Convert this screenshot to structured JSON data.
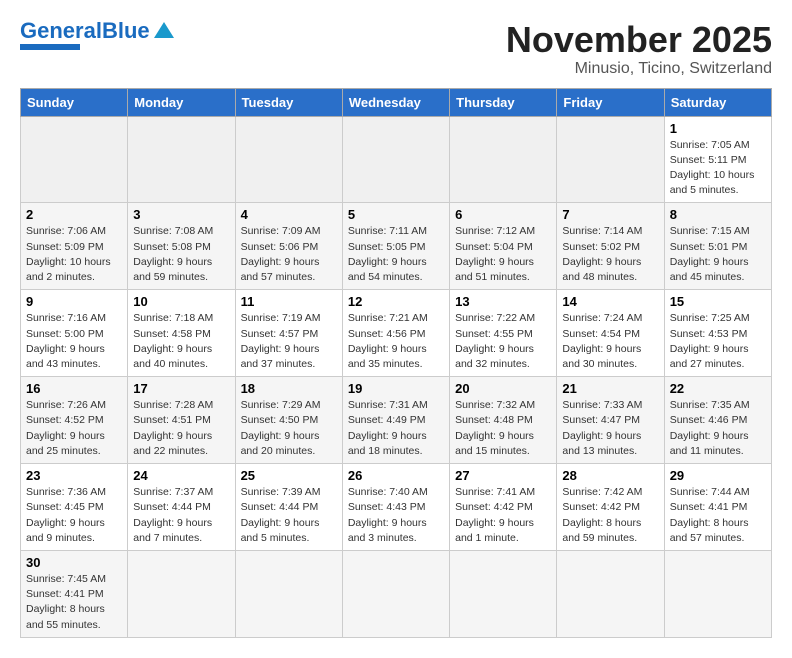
{
  "header": {
    "logo_general": "General",
    "logo_blue": "Blue",
    "month": "November 2025",
    "location": "Minusio, Ticino, Switzerland"
  },
  "days_of_week": [
    "Sunday",
    "Monday",
    "Tuesday",
    "Wednesday",
    "Thursday",
    "Friday",
    "Saturday"
  ],
  "weeks": [
    [
      {
        "num": "",
        "info": ""
      },
      {
        "num": "",
        "info": ""
      },
      {
        "num": "",
        "info": ""
      },
      {
        "num": "",
        "info": ""
      },
      {
        "num": "",
        "info": ""
      },
      {
        "num": "",
        "info": ""
      },
      {
        "num": "1",
        "info": "Sunrise: 7:05 AM\nSunset: 5:11 PM\nDaylight: 10 hours and 5 minutes."
      }
    ],
    [
      {
        "num": "2",
        "info": "Sunrise: 7:06 AM\nSunset: 5:09 PM\nDaylight: 10 hours and 2 minutes."
      },
      {
        "num": "3",
        "info": "Sunrise: 7:08 AM\nSunset: 5:08 PM\nDaylight: 9 hours and 59 minutes."
      },
      {
        "num": "4",
        "info": "Sunrise: 7:09 AM\nSunset: 5:06 PM\nDaylight: 9 hours and 57 minutes."
      },
      {
        "num": "5",
        "info": "Sunrise: 7:11 AM\nSunset: 5:05 PM\nDaylight: 9 hours and 54 minutes."
      },
      {
        "num": "6",
        "info": "Sunrise: 7:12 AM\nSunset: 5:04 PM\nDaylight: 9 hours and 51 minutes."
      },
      {
        "num": "7",
        "info": "Sunrise: 7:14 AM\nSunset: 5:02 PM\nDaylight: 9 hours and 48 minutes."
      },
      {
        "num": "8",
        "info": "Sunrise: 7:15 AM\nSunset: 5:01 PM\nDaylight: 9 hours and 45 minutes."
      }
    ],
    [
      {
        "num": "9",
        "info": "Sunrise: 7:16 AM\nSunset: 5:00 PM\nDaylight: 9 hours and 43 minutes."
      },
      {
        "num": "10",
        "info": "Sunrise: 7:18 AM\nSunset: 4:58 PM\nDaylight: 9 hours and 40 minutes."
      },
      {
        "num": "11",
        "info": "Sunrise: 7:19 AM\nSunset: 4:57 PM\nDaylight: 9 hours and 37 minutes."
      },
      {
        "num": "12",
        "info": "Sunrise: 7:21 AM\nSunset: 4:56 PM\nDaylight: 9 hours and 35 minutes."
      },
      {
        "num": "13",
        "info": "Sunrise: 7:22 AM\nSunset: 4:55 PM\nDaylight: 9 hours and 32 minutes."
      },
      {
        "num": "14",
        "info": "Sunrise: 7:24 AM\nSunset: 4:54 PM\nDaylight: 9 hours and 30 minutes."
      },
      {
        "num": "15",
        "info": "Sunrise: 7:25 AM\nSunset: 4:53 PM\nDaylight: 9 hours and 27 minutes."
      }
    ],
    [
      {
        "num": "16",
        "info": "Sunrise: 7:26 AM\nSunset: 4:52 PM\nDaylight: 9 hours and 25 minutes."
      },
      {
        "num": "17",
        "info": "Sunrise: 7:28 AM\nSunset: 4:51 PM\nDaylight: 9 hours and 22 minutes."
      },
      {
        "num": "18",
        "info": "Sunrise: 7:29 AM\nSunset: 4:50 PM\nDaylight: 9 hours and 20 minutes."
      },
      {
        "num": "19",
        "info": "Sunrise: 7:31 AM\nSunset: 4:49 PM\nDaylight: 9 hours and 18 minutes."
      },
      {
        "num": "20",
        "info": "Sunrise: 7:32 AM\nSunset: 4:48 PM\nDaylight: 9 hours and 15 minutes."
      },
      {
        "num": "21",
        "info": "Sunrise: 7:33 AM\nSunset: 4:47 PM\nDaylight: 9 hours and 13 minutes."
      },
      {
        "num": "22",
        "info": "Sunrise: 7:35 AM\nSunset: 4:46 PM\nDaylight: 9 hours and 11 minutes."
      }
    ],
    [
      {
        "num": "23",
        "info": "Sunrise: 7:36 AM\nSunset: 4:45 PM\nDaylight: 9 hours and 9 minutes."
      },
      {
        "num": "24",
        "info": "Sunrise: 7:37 AM\nSunset: 4:44 PM\nDaylight: 9 hours and 7 minutes."
      },
      {
        "num": "25",
        "info": "Sunrise: 7:39 AM\nSunset: 4:44 PM\nDaylight: 9 hours and 5 minutes."
      },
      {
        "num": "26",
        "info": "Sunrise: 7:40 AM\nSunset: 4:43 PM\nDaylight: 9 hours and 3 minutes."
      },
      {
        "num": "27",
        "info": "Sunrise: 7:41 AM\nSunset: 4:42 PM\nDaylight: 9 hours and 1 minute."
      },
      {
        "num": "28",
        "info": "Sunrise: 7:42 AM\nSunset: 4:42 PM\nDaylight: 8 hours and 59 minutes."
      },
      {
        "num": "29",
        "info": "Sunrise: 7:44 AM\nSunset: 4:41 PM\nDaylight: 8 hours and 57 minutes."
      }
    ],
    [
      {
        "num": "30",
        "info": "Sunrise: 7:45 AM\nSunset: 4:41 PM\nDaylight: 8 hours and 55 minutes."
      },
      {
        "num": "",
        "info": ""
      },
      {
        "num": "",
        "info": ""
      },
      {
        "num": "",
        "info": ""
      },
      {
        "num": "",
        "info": ""
      },
      {
        "num": "",
        "info": ""
      },
      {
        "num": "",
        "info": ""
      }
    ]
  ]
}
